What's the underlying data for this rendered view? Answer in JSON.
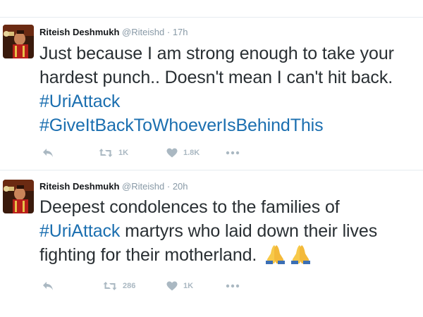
{
  "tweets": [
    {
      "author": "Riteish Deshmukh",
      "handle": "@Riteishd",
      "separator": "·",
      "time": "17h",
      "text_parts": [
        "Just because I am strong enough to take your hardest punch.. Doesn't mean I can't hit back. ",
        "#UriAttack",
        "#GiveItBackToWhoeverIsBehindThis"
      ],
      "retweets": "1K",
      "likes": "1.8K",
      "icons": [
        "reply-icon",
        "retweet-icon",
        "heart-icon",
        "more-icon"
      ]
    },
    {
      "author": "Riteish Deshmukh",
      "handle": "@Riteishd",
      "separator": "·",
      "time": "20h",
      "text_parts": [
        "Deepest condolences to the families of ",
        "#UriAttack",
        " martyrs who laid down their lives fighting for their motherland. "
      ],
      "retweets": "286",
      "likes": "1K",
      "icons": [
        "reply-icon",
        "retweet-icon",
        "heart-icon",
        "more-icon",
        "folded-hands-emoji"
      ]
    }
  ],
  "colors": {
    "hashtag": "#1b6fb0",
    "text": "#292f33",
    "muted": "#8899a6",
    "action": "#aab8c2",
    "divider": "#e6ecf0"
  }
}
